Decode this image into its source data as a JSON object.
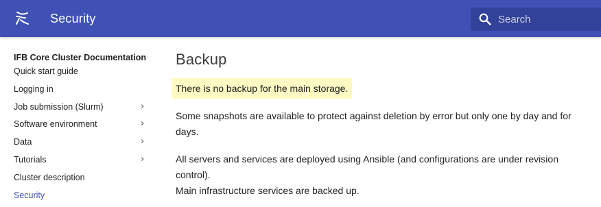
{
  "header": {
    "title": "Security",
    "search": {
      "placeholder": "Search",
      "value": ""
    }
  },
  "sidebar": {
    "title": "IFB Core Cluster Documentation",
    "items": [
      {
        "label": "Quick start guide",
        "expandable": false,
        "active": false
      },
      {
        "label": "Logging in",
        "expandable": false,
        "active": false
      },
      {
        "label": "Job submission (Slurm)",
        "expandable": true,
        "active": false
      },
      {
        "label": "Software environment",
        "expandable": true,
        "active": false
      },
      {
        "label": "Data",
        "expandable": true,
        "active": false
      },
      {
        "label": "Tutorials",
        "expandable": true,
        "active": false
      },
      {
        "label": "Cluster description",
        "expandable": false,
        "active": false
      },
      {
        "label": "Security",
        "expandable": false,
        "active": true
      }
    ],
    "chevron": "›"
  },
  "main": {
    "heading": "Backup",
    "highlight": "There is no backup for the main storage.",
    "para1": [
      "Some snapshots are available to protect against deletion by error but only one by day and for",
      "days."
    ],
    "para2": [
      "All servers and services are deployed using Ansible (and configurations are under revision",
      "control).",
      "Main infrastructure services are backed up."
    ]
  },
  "colors": {
    "header_bg": "#3f51b5",
    "search_bg": "#32419a",
    "active_link": "#3f51b5",
    "highlight_bg": "#fff9c4"
  },
  "icons": {
    "logo": "ifb-logo-icon",
    "search": "search-icon"
  }
}
